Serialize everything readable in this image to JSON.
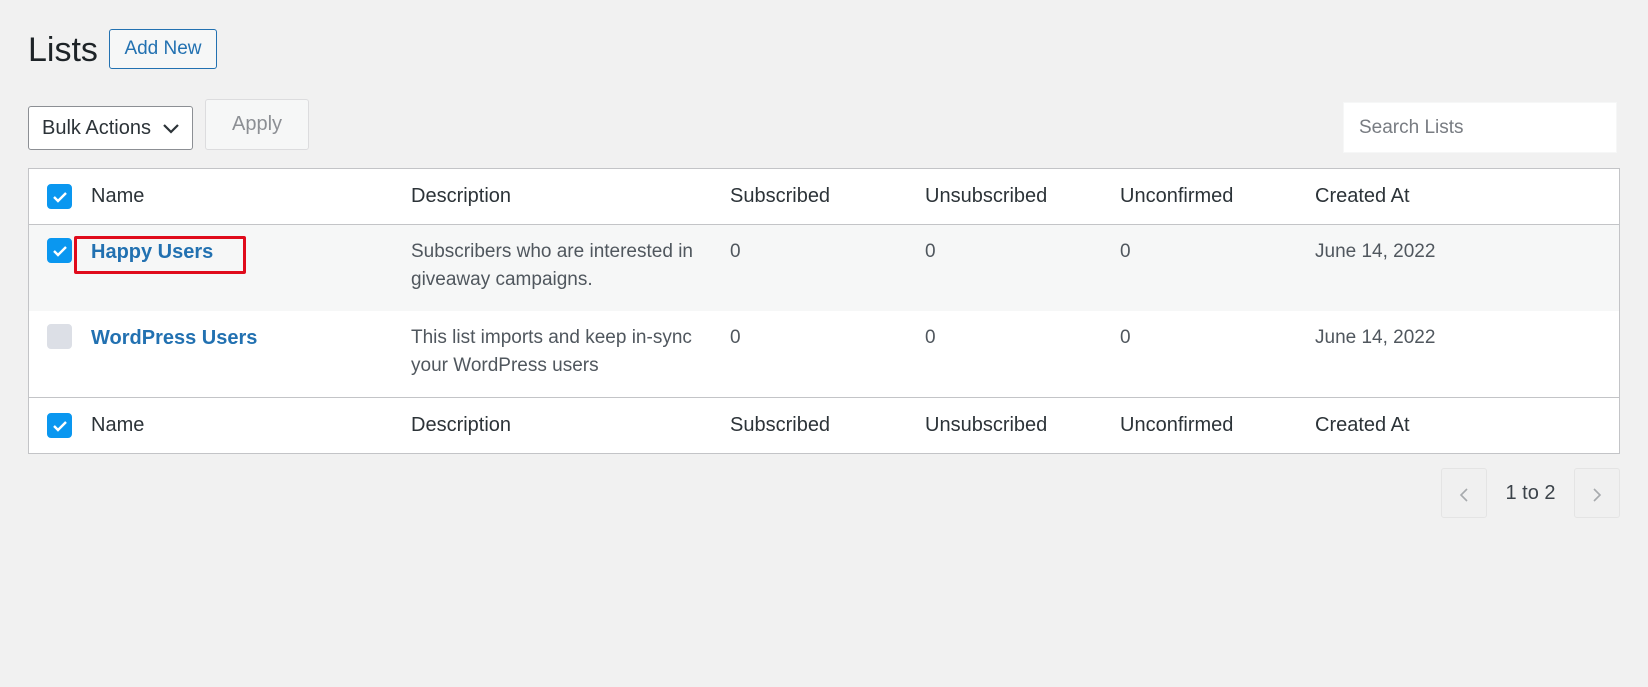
{
  "header": {
    "title": "Lists",
    "add_new_label": "Add New"
  },
  "toolbar": {
    "bulk_actions_selected": "Bulk Actions",
    "apply_label": "Apply",
    "search_placeholder": "Search Lists"
  },
  "table": {
    "columns": [
      "Name",
      "Description",
      "Subscribed",
      "Unsubscribed",
      "Unconfirmed",
      "Created At"
    ],
    "header_checked": true,
    "footer_checked": true,
    "rows": [
      {
        "checked": true,
        "name": "Happy Users",
        "description": "Subscribers who are interested in giveaway campaigns.",
        "subscribed": "0",
        "unsubscribed": "0",
        "unconfirmed": "0",
        "created_at": "June 14, 2022"
      },
      {
        "checked": false,
        "name": "WordPress Users",
        "description": "This list imports and keep in-sync your WordPress users",
        "subscribed": "0",
        "unsubscribed": "0",
        "unconfirmed": "0",
        "created_at": "June 14, 2022"
      }
    ]
  },
  "pagination": {
    "label": "1 to 2",
    "prev_icon": "chevron-left-icon",
    "next_icon": "chevron-right-icon"
  },
  "colors": {
    "accent": "#2271b1",
    "checkbox": "#0a97f0",
    "highlight": "#e00b1c"
  }
}
